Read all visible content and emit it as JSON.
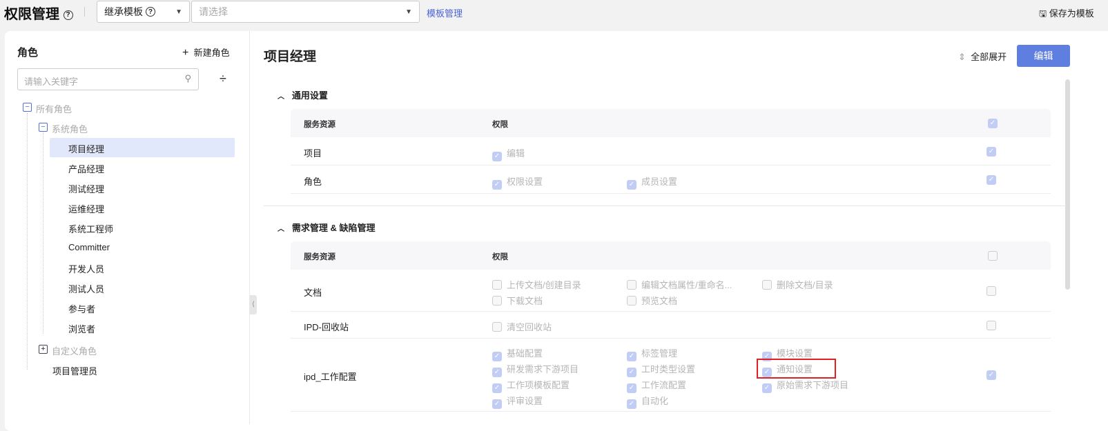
{
  "header": {
    "title": "权限管理",
    "help": "?",
    "inherit_label": "继承模板",
    "select_placeholder": "请选择",
    "template_link": "模板管理",
    "save_template": "保存为模板"
  },
  "roles": {
    "title": "角色",
    "new_role": "新建角色",
    "search_placeholder": "请输入关键字",
    "all": "所有角色",
    "system": "系统角色",
    "system_items": [
      "项目经理",
      "产品经理",
      "测试经理",
      "运维经理",
      "系统工程师",
      "Committer",
      "开发人员",
      "测试人员",
      "参与者",
      "浏览者"
    ],
    "custom": "自定义角色",
    "admin": "项目管理员"
  },
  "detail": {
    "title": "项目经理",
    "expand_all": "全部展开",
    "edit": "编辑",
    "col_resource": "服务资源",
    "col_permission": "权限",
    "sections": [
      {
        "title": "通用设置",
        "all_checked": true,
        "rows": [
          {
            "name": "项目",
            "checked": true,
            "perms": [
              {
                "label": "编辑",
                "checked": true
              }
            ]
          },
          {
            "name": "角色",
            "checked": true,
            "perms": [
              {
                "label": "权限设置",
                "checked": true
              },
              {
                "label": "成员设置",
                "checked": true
              }
            ]
          }
        ]
      },
      {
        "title": "需求管理 & 缺陷管理",
        "all_checked": false,
        "rows": [
          {
            "name": "文档",
            "checked": false,
            "perms": [
              {
                "label": "上传文档/创建目录",
                "checked": false
              },
              {
                "label": "编辑文档属性/重命名...",
                "checked": false
              },
              {
                "label": "删除文档/目录",
                "checked": false
              },
              {
                "label": "下载文档",
                "checked": false
              },
              {
                "label": "预览文档",
                "checked": false
              }
            ]
          },
          {
            "name": "IPD-回收站",
            "checked": false,
            "perms": [
              {
                "label": "清空回收站",
                "checked": false
              }
            ]
          },
          {
            "name": "ipd_工作配置",
            "checked": true,
            "perms": [
              {
                "label": "基础配置",
                "checked": true
              },
              {
                "label": "标签管理",
                "checked": true
              },
              {
                "label": "模块设置",
                "checked": true
              },
              {
                "label": "研发需求下游项目",
                "checked": true
              },
              {
                "label": "工时类型设置",
                "checked": true
              },
              {
                "label": "通知设置",
                "checked": true
              },
              {
                "label": "工作项模板配置",
                "checked": true
              },
              {
                "label": "工作流配置",
                "checked": true
              },
              {
                "label": "原始需求下游项目",
                "checked": true
              },
              {
                "label": "评审设置",
                "checked": true
              },
              {
                "label": "自动化",
                "checked": true
              }
            ]
          }
        ]
      }
    ]
  },
  "colors": {
    "accent": "#5f7fe0",
    "check": "#c1cdf5",
    "highlight": "#e02020"
  }
}
